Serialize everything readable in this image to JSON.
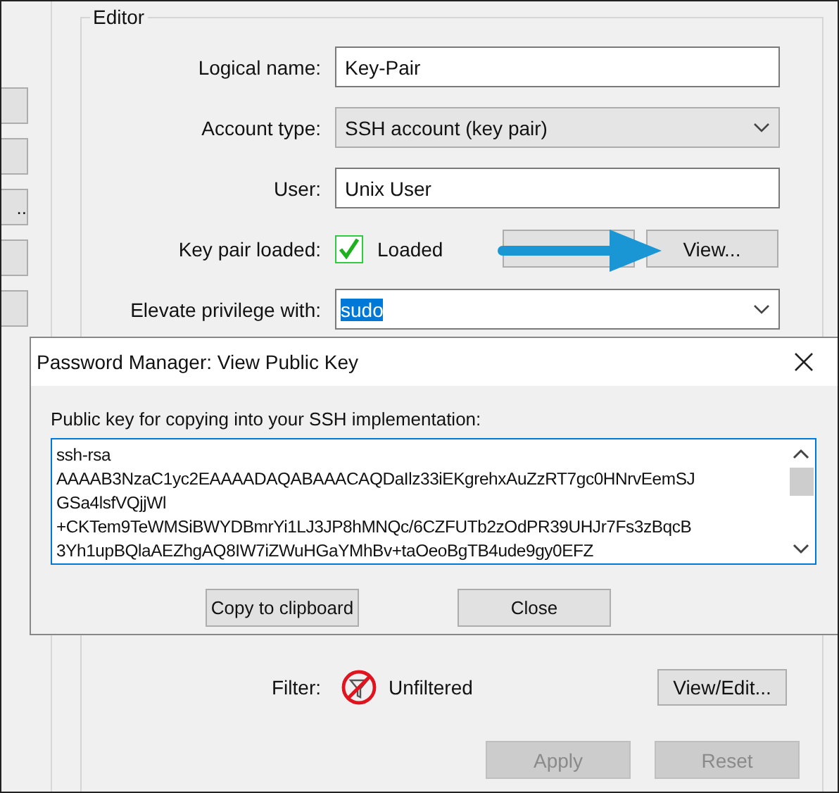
{
  "side_buttons": [
    {
      "kind": "blank"
    },
    {
      "kind": "blank"
    },
    {
      "kind": "labeled",
      "label": ".."
    },
    {
      "kind": "blank"
    },
    {
      "kind": "blank"
    }
  ],
  "editor": {
    "title": "Editor",
    "fields": [
      {
        "kind": "text",
        "label": "Logical name:",
        "value": "Key-Pair"
      },
      {
        "kind": "select",
        "label": "Account type:",
        "value": "SSH account (key pair)"
      },
      {
        "kind": "text",
        "label": "User:",
        "value": "Unix User"
      },
      {
        "kind": "keypair",
        "label": "Key pair loaded:",
        "checked": true,
        "status": "Loaded",
        "button": "View..."
      },
      {
        "kind": "combo",
        "label": "Elevate privilege with:",
        "value": "sudo",
        "selected": true
      }
    ],
    "filter": {
      "label": "Filter:",
      "status": "Unfiltered",
      "button": "View/Edit..."
    },
    "actions": [
      {
        "label": "Apply",
        "disabled": true
      },
      {
        "label": "Reset",
        "disabled": true
      }
    ]
  },
  "dialog": {
    "title": "Password Manager: View Public Key",
    "prompt": "Public key for copying into your SSH implementation:",
    "key_lines": [
      "ssh-rsa",
      "AAAAB3NzaC1yc2EAAAADAQABAAACAQDaIlz33iEKgrehxAuZzRT7gc0HNrvEemSJ",
      "GSa4lsfVQjjWl",
      "+CKTem9TeWMSiBWYDBmrYi1LJ3JP8hMNQc/6CZFUTb2zOdPR39UHJr7Fs3zBqcB",
      "3Yh1upBQlaAEZhgAQ8IW7iZWuHGaYMhBv+taOeoBgTB4ude9gy0EFZ"
    ],
    "buttons": [
      "Copy to clipboard",
      "Close"
    ]
  }
}
